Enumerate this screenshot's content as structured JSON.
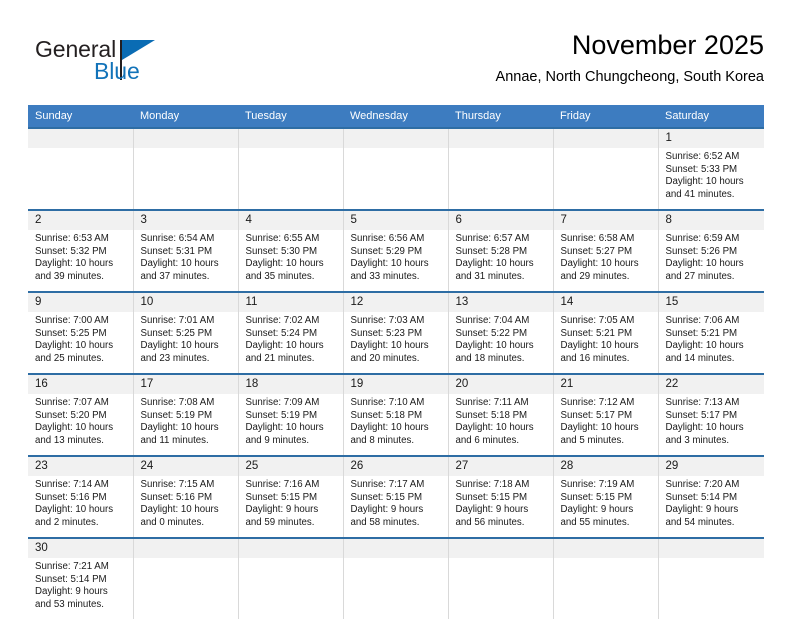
{
  "brand": {
    "name_part1": "General",
    "name_part2": "Blue",
    "triangle_icon": "triangle-logo-icon",
    "accent_color": "#0a6cb4",
    "text_color": "#231f20"
  },
  "header": {
    "title": "November 2025",
    "subtitle": "Annae, North Chungcheong, South Korea"
  },
  "theme": {
    "header_blue": "#3d7cc0",
    "separator_blue": "#2e6da4",
    "daynum_band": "#f1f1f1",
    "column_divider": "#d9d9d9"
  },
  "weekday_headers": [
    "Sunday",
    "Monday",
    "Tuesday",
    "Wednesday",
    "Thursday",
    "Friday",
    "Saturday"
  ],
  "weeks": [
    {
      "days": [
        {
          "num": "",
          "sunrise": "",
          "sunset": "",
          "daylight1": "",
          "daylight2": "",
          "empty": true
        },
        {
          "num": "",
          "sunrise": "",
          "sunset": "",
          "daylight1": "",
          "daylight2": "",
          "empty": true
        },
        {
          "num": "",
          "sunrise": "",
          "sunset": "",
          "daylight1": "",
          "daylight2": "",
          "empty": true
        },
        {
          "num": "",
          "sunrise": "",
          "sunset": "",
          "daylight1": "",
          "daylight2": "",
          "empty": true
        },
        {
          "num": "",
          "sunrise": "",
          "sunset": "",
          "daylight1": "",
          "daylight2": "",
          "empty": true
        },
        {
          "num": "",
          "sunrise": "",
          "sunset": "",
          "daylight1": "",
          "daylight2": "",
          "empty": true
        },
        {
          "num": "1",
          "sunrise": "Sunrise: 6:52 AM",
          "sunset": "Sunset: 5:33 PM",
          "daylight1": "Daylight: 10 hours",
          "daylight2": "and 41 minutes.",
          "empty": false
        }
      ]
    },
    {
      "days": [
        {
          "num": "2",
          "sunrise": "Sunrise: 6:53 AM",
          "sunset": "Sunset: 5:32 PM",
          "daylight1": "Daylight: 10 hours",
          "daylight2": "and 39 minutes.",
          "empty": false
        },
        {
          "num": "3",
          "sunrise": "Sunrise: 6:54 AM",
          "sunset": "Sunset: 5:31 PM",
          "daylight1": "Daylight: 10 hours",
          "daylight2": "and 37 minutes.",
          "empty": false
        },
        {
          "num": "4",
          "sunrise": "Sunrise: 6:55 AM",
          "sunset": "Sunset: 5:30 PM",
          "daylight1": "Daylight: 10 hours",
          "daylight2": "and 35 minutes.",
          "empty": false
        },
        {
          "num": "5",
          "sunrise": "Sunrise: 6:56 AM",
          "sunset": "Sunset: 5:29 PM",
          "daylight1": "Daylight: 10 hours",
          "daylight2": "and 33 minutes.",
          "empty": false
        },
        {
          "num": "6",
          "sunrise": "Sunrise: 6:57 AM",
          "sunset": "Sunset: 5:28 PM",
          "daylight1": "Daylight: 10 hours",
          "daylight2": "and 31 minutes.",
          "empty": false
        },
        {
          "num": "7",
          "sunrise": "Sunrise: 6:58 AM",
          "sunset": "Sunset: 5:27 PM",
          "daylight1": "Daylight: 10 hours",
          "daylight2": "and 29 minutes.",
          "empty": false
        },
        {
          "num": "8",
          "sunrise": "Sunrise: 6:59 AM",
          "sunset": "Sunset: 5:26 PM",
          "daylight1": "Daylight: 10 hours",
          "daylight2": "and 27 minutes.",
          "empty": false
        }
      ]
    },
    {
      "days": [
        {
          "num": "9",
          "sunrise": "Sunrise: 7:00 AM",
          "sunset": "Sunset: 5:25 PM",
          "daylight1": "Daylight: 10 hours",
          "daylight2": "and 25 minutes.",
          "empty": false
        },
        {
          "num": "10",
          "sunrise": "Sunrise: 7:01 AM",
          "sunset": "Sunset: 5:25 PM",
          "daylight1": "Daylight: 10 hours",
          "daylight2": "and 23 minutes.",
          "empty": false
        },
        {
          "num": "11",
          "sunrise": "Sunrise: 7:02 AM",
          "sunset": "Sunset: 5:24 PM",
          "daylight1": "Daylight: 10 hours",
          "daylight2": "and 21 minutes.",
          "empty": false
        },
        {
          "num": "12",
          "sunrise": "Sunrise: 7:03 AM",
          "sunset": "Sunset: 5:23 PM",
          "daylight1": "Daylight: 10 hours",
          "daylight2": "and 20 minutes.",
          "empty": false
        },
        {
          "num": "13",
          "sunrise": "Sunrise: 7:04 AM",
          "sunset": "Sunset: 5:22 PM",
          "daylight1": "Daylight: 10 hours",
          "daylight2": "and 18 minutes.",
          "empty": false
        },
        {
          "num": "14",
          "sunrise": "Sunrise: 7:05 AM",
          "sunset": "Sunset: 5:21 PM",
          "daylight1": "Daylight: 10 hours",
          "daylight2": "and 16 minutes.",
          "empty": false
        },
        {
          "num": "15",
          "sunrise": "Sunrise: 7:06 AM",
          "sunset": "Sunset: 5:21 PM",
          "daylight1": "Daylight: 10 hours",
          "daylight2": "and 14 minutes.",
          "empty": false
        }
      ]
    },
    {
      "days": [
        {
          "num": "16",
          "sunrise": "Sunrise: 7:07 AM",
          "sunset": "Sunset: 5:20 PM",
          "daylight1": "Daylight: 10 hours",
          "daylight2": "and 13 minutes.",
          "empty": false
        },
        {
          "num": "17",
          "sunrise": "Sunrise: 7:08 AM",
          "sunset": "Sunset: 5:19 PM",
          "daylight1": "Daylight: 10 hours",
          "daylight2": "and 11 minutes.",
          "empty": false
        },
        {
          "num": "18",
          "sunrise": "Sunrise: 7:09 AM",
          "sunset": "Sunset: 5:19 PM",
          "daylight1": "Daylight: 10 hours",
          "daylight2": "and 9 minutes.",
          "empty": false
        },
        {
          "num": "19",
          "sunrise": "Sunrise: 7:10 AM",
          "sunset": "Sunset: 5:18 PM",
          "daylight1": "Daylight: 10 hours",
          "daylight2": "and 8 minutes.",
          "empty": false
        },
        {
          "num": "20",
          "sunrise": "Sunrise: 7:11 AM",
          "sunset": "Sunset: 5:18 PM",
          "daylight1": "Daylight: 10 hours",
          "daylight2": "and 6 minutes.",
          "empty": false
        },
        {
          "num": "21",
          "sunrise": "Sunrise: 7:12 AM",
          "sunset": "Sunset: 5:17 PM",
          "daylight1": "Daylight: 10 hours",
          "daylight2": "and 5 minutes.",
          "empty": false
        },
        {
          "num": "22",
          "sunrise": "Sunrise: 7:13 AM",
          "sunset": "Sunset: 5:17 PM",
          "daylight1": "Daylight: 10 hours",
          "daylight2": "and 3 minutes.",
          "empty": false
        }
      ]
    },
    {
      "days": [
        {
          "num": "23",
          "sunrise": "Sunrise: 7:14 AM",
          "sunset": "Sunset: 5:16 PM",
          "daylight1": "Daylight: 10 hours",
          "daylight2": "and 2 minutes.",
          "empty": false
        },
        {
          "num": "24",
          "sunrise": "Sunrise: 7:15 AM",
          "sunset": "Sunset: 5:16 PM",
          "daylight1": "Daylight: 10 hours",
          "daylight2": "and 0 minutes.",
          "empty": false
        },
        {
          "num": "25",
          "sunrise": "Sunrise: 7:16 AM",
          "sunset": "Sunset: 5:15 PM",
          "daylight1": "Daylight: 9 hours",
          "daylight2": "and 59 minutes.",
          "empty": false
        },
        {
          "num": "26",
          "sunrise": "Sunrise: 7:17 AM",
          "sunset": "Sunset: 5:15 PM",
          "daylight1": "Daylight: 9 hours",
          "daylight2": "and 58 minutes.",
          "empty": false
        },
        {
          "num": "27",
          "sunrise": "Sunrise: 7:18 AM",
          "sunset": "Sunset: 5:15 PM",
          "daylight1": "Daylight: 9 hours",
          "daylight2": "and 56 minutes.",
          "empty": false
        },
        {
          "num": "28",
          "sunrise": "Sunrise: 7:19 AM",
          "sunset": "Sunset: 5:15 PM",
          "daylight1": "Daylight: 9 hours",
          "daylight2": "and 55 minutes.",
          "empty": false
        },
        {
          "num": "29",
          "sunrise": "Sunrise: 7:20 AM",
          "sunset": "Sunset: 5:14 PM",
          "daylight1": "Daylight: 9 hours",
          "daylight2": "and 54 minutes.",
          "empty": false
        }
      ]
    },
    {
      "days": [
        {
          "num": "30",
          "sunrise": "Sunrise: 7:21 AM",
          "sunset": "Sunset: 5:14 PM",
          "daylight1": "Daylight: 9 hours",
          "daylight2": "and 53 minutes.",
          "empty": false
        },
        {
          "num": "",
          "sunrise": "",
          "sunset": "",
          "daylight1": "",
          "daylight2": "",
          "empty": true
        },
        {
          "num": "",
          "sunrise": "",
          "sunset": "",
          "daylight1": "",
          "daylight2": "",
          "empty": true
        },
        {
          "num": "",
          "sunrise": "",
          "sunset": "",
          "daylight1": "",
          "daylight2": "",
          "empty": true
        },
        {
          "num": "",
          "sunrise": "",
          "sunset": "",
          "daylight1": "",
          "daylight2": "",
          "empty": true
        },
        {
          "num": "",
          "sunrise": "",
          "sunset": "",
          "daylight1": "",
          "daylight2": "",
          "empty": true
        },
        {
          "num": "",
          "sunrise": "",
          "sunset": "",
          "daylight1": "",
          "daylight2": "",
          "empty": true
        }
      ]
    }
  ]
}
